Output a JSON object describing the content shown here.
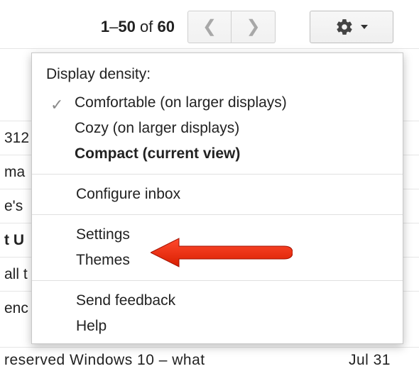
{
  "toolbar": {
    "range_start": "1",
    "range_end": "50",
    "of": "of",
    "total": "60"
  },
  "menu": {
    "density_header": "Display density:",
    "comfortable": "Comfortable (on larger displays)",
    "cozy": "Cozy (on larger displays)",
    "compact": "Compact (current view)",
    "configure_inbox": "Configure inbox",
    "settings": "Settings",
    "themes": "Themes",
    "send_feedback": "Send feedback",
    "help": "Help"
  },
  "bg": {
    "r0": "312",
    "r1": "ma",
    "r2": "e's",
    "r3": "t U",
    "r4": "all t",
    "r5": "enc",
    "last_text": "reserved Windows 10 – what",
    "last_date": "Jul 31"
  }
}
